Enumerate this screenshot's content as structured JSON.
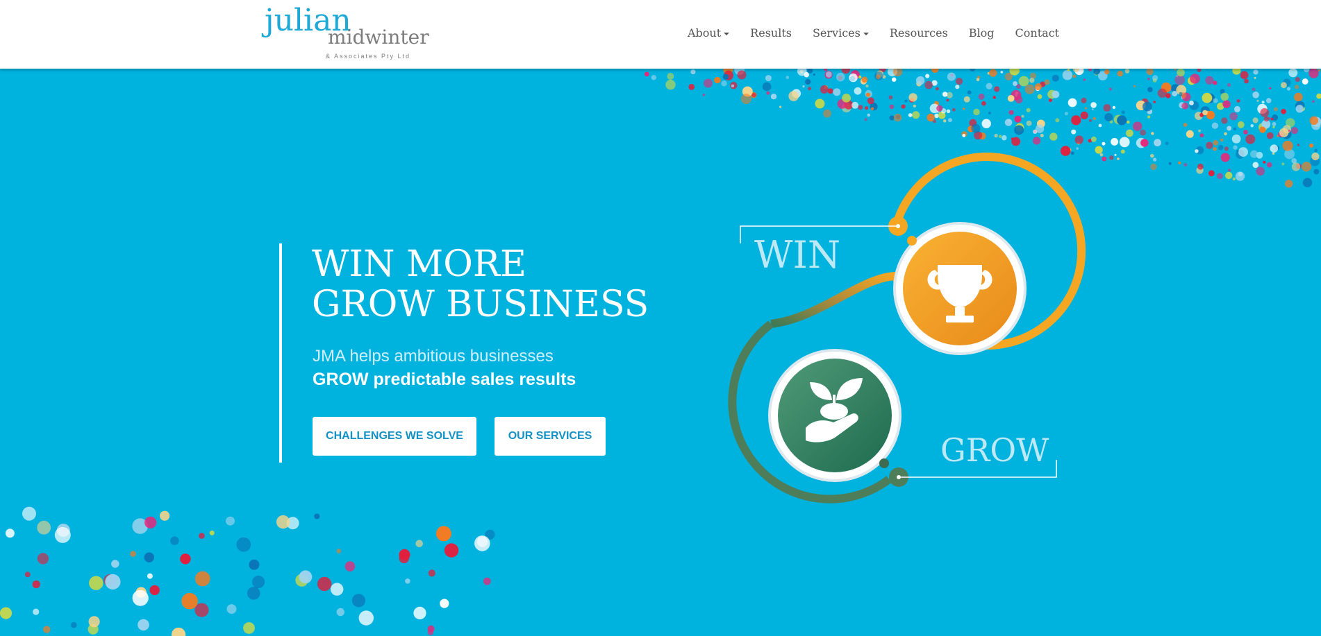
{
  "logo": {
    "line1": "julian",
    "line2": "midwinter",
    "line3": "& Associates Pty Ltd"
  },
  "nav": {
    "about": "About",
    "results": "Results",
    "services": "Services",
    "resources": "Resources",
    "blog": "Blog",
    "contact": "Contact"
  },
  "hero": {
    "headline_line1": "WIN MORE",
    "headline_line2": "GROW BUSINESS",
    "sub_line1": "JMA helps ambitious businesses",
    "sub_line2": "GROW predictable sales results",
    "btn_challenges": "CHALLENGES WE SOLVE",
    "btn_services": "OUR SERVICES"
  },
  "graphic": {
    "win_label": "WIN",
    "grow_label": "GROW"
  },
  "icons": [
    "trophy-icon",
    "sprout-in-hand-icon"
  ],
  "colors": {
    "hero_bg": "#00b2de",
    "orange": "#f5a623",
    "green": "#2e7d5b",
    "button_text": "#1291c6"
  }
}
